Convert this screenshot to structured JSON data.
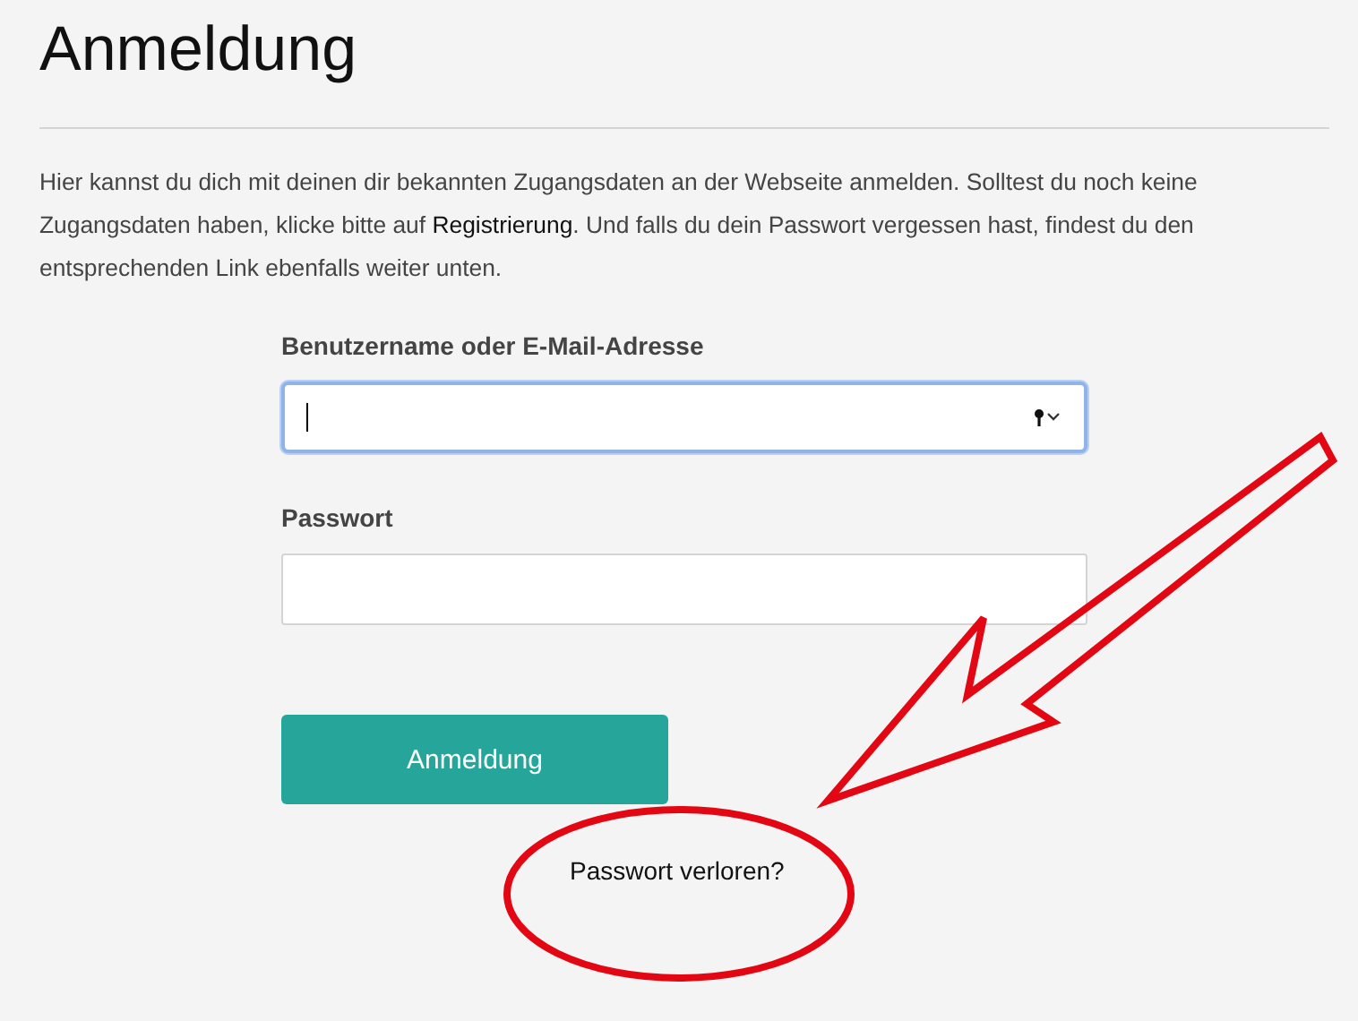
{
  "title": "Anmeldung",
  "intro": {
    "before": "Hier kannst du dich mit deinen dir bekannten Zugangsdaten an der Webseite anmelden. Solltest du noch keine Zugangsdaten haben, klicke bitte auf ",
    "link": "Registrierung",
    "after": ". Und falls du dein Passwort vergessen hast, findest du den entsprechenden Link ebenfalls weiter unten."
  },
  "fields": [
    {
      "label": "Benutzername oder E-Mail-Adresse",
      "focused": true,
      "autofill": true
    },
    {
      "label": "Passwort",
      "focused": false,
      "autofill": false
    }
  ],
  "submit": "Anmeldung",
  "lost_password": "Passwort verloren?"
}
